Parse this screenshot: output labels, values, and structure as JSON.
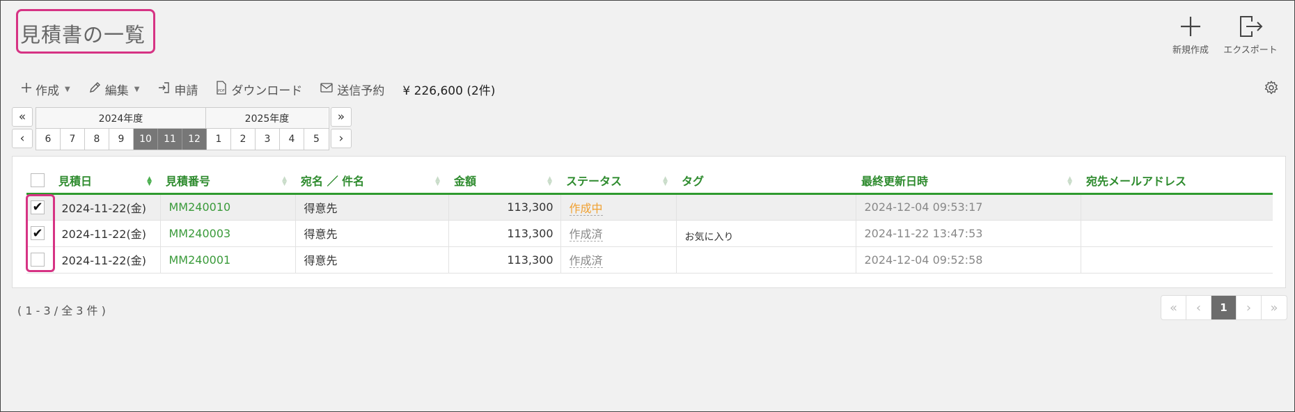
{
  "page": {
    "title": "見積書の一覧"
  },
  "top_actions": {
    "new_label": "新規作成",
    "export_label": "エクスポート"
  },
  "toolbar": {
    "create_label": "作成",
    "edit_label": "編集",
    "apply_label": "申請",
    "download_label": "ダウンロード",
    "schedule_label": "送信予約",
    "total": "¥ 226,600 (2件)"
  },
  "period": {
    "fiscal_years": [
      "2024年度",
      "2025年度"
    ],
    "months": [
      "6",
      "7",
      "8",
      "9",
      "10",
      "11",
      "12",
      "1",
      "2",
      "3",
      "4",
      "5"
    ],
    "selected_months": [
      "10",
      "11",
      "12"
    ],
    "nav": {
      "first": "«",
      "prev": "‹",
      "last": "»",
      "next": "›"
    }
  },
  "table": {
    "columns": [
      "見積日",
      "見積番号",
      "宛名 ／ 件名",
      "金額",
      "ステータス",
      "タグ",
      "最終更新日時",
      "宛先メールアドレス"
    ],
    "rows": [
      {
        "checked": true,
        "date": "2024-11-22(金)",
        "number": "MM240010",
        "recipient": "得意先",
        "amount": "113,300",
        "status": "作成中",
        "tag": "",
        "updated": "2024-12-04 09:53:17",
        "email": ""
      },
      {
        "checked": true,
        "date": "2024-11-22(金)",
        "number": "MM240003",
        "recipient": "得意先",
        "amount": "113,300",
        "status": "作成済",
        "tag": "お気に入り",
        "updated": "2024-11-22 13:47:53",
        "email": ""
      },
      {
        "checked": false,
        "date": "2024-11-22(金)",
        "number": "MM240001",
        "recipient": "得意先",
        "amount": "113,300",
        "status": "作成済",
        "tag": "",
        "updated": "2024-12-04 09:52:58",
        "email": ""
      }
    ]
  },
  "pagination": {
    "range_text": "( 1 - 3 / 全 3 件 )",
    "current_page": "1",
    "first": "«",
    "prev": "‹",
    "next": "›",
    "last": "»"
  },
  "colors": {
    "accent_green": "#2e9a2e",
    "highlight_pink": "#d63384",
    "status_in_progress": "#f0a030"
  }
}
